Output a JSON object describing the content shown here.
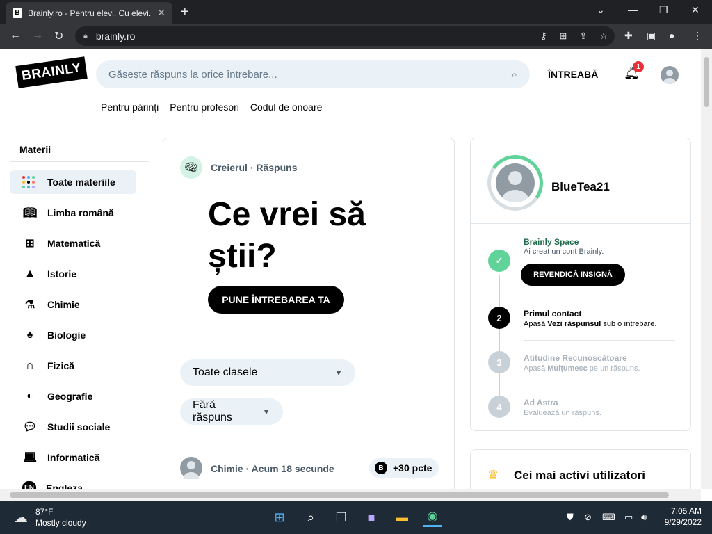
{
  "browser": {
    "tab_title": "Brainly.ro - Pentru elevi. Cu elevi.",
    "tab_favicon": "B",
    "url": "brainly.ro"
  },
  "header": {
    "logo": "BRAINLY",
    "search_placeholder": "Găsește răspuns la orice întrebare...",
    "ask_label": "ÎNTREABĂ",
    "notif_count": "1",
    "subnav": [
      "Pentru părinți",
      "Pentru profesori",
      "Codul de onoare"
    ]
  },
  "sidebar": {
    "title": "Materii",
    "items": [
      {
        "label": "Toate materiile",
        "icon": "all-subjects-icon"
      },
      {
        "label": "Limba română",
        "icon": "book-icon"
      },
      {
        "label": "Matematică",
        "icon": "math-icon"
      },
      {
        "label": "Istorie",
        "icon": "history-icon"
      },
      {
        "label": "Chimie",
        "icon": "flask-icon"
      },
      {
        "label": "Biologie",
        "icon": "leaf-icon"
      },
      {
        "label": "Fizică",
        "icon": "magnet-icon"
      },
      {
        "label": "Geografie",
        "icon": "globe-icon"
      },
      {
        "label": "Studii sociale",
        "icon": "chat-icon"
      },
      {
        "label": "Informatică",
        "icon": "laptop-icon"
      },
      {
        "label": "Engleza",
        "icon": "en-icon"
      }
    ]
  },
  "main": {
    "mascot_label": "Creierul",
    "mascot_sep": "·",
    "mascot_action": "Răspuns",
    "headline": "Ce vrei să știi?",
    "cta": "PUNE ÎNTREBAREA TA",
    "filter_grade": "Toate clasele",
    "filter_status": "Fără răspuns",
    "post_subject": "Chimie",
    "post_sep": "·",
    "post_time": "Acum 18 secunde",
    "post_points": "+30 pcte",
    "coin_glyph": "B"
  },
  "profile": {
    "username": "BlueTea21",
    "steps": [
      {
        "num": "✓",
        "title": "Brainly Space",
        "desc": "Ai creat un cont Brainly.",
        "state": "done"
      },
      {
        "num": "2",
        "title": "Primul contact",
        "desc_pre": "Apasă ",
        "desc_bold": "Vezi răspunsul",
        "desc_post": " sub o întrebare.",
        "state": "current"
      },
      {
        "num": "3",
        "title": "Atitudine Recunoscătoare",
        "desc_pre": "Apasă ",
        "desc_bold": "Mulțumesc",
        "desc_post": " pe un răspuns.",
        "state": "locked"
      },
      {
        "num": "4",
        "title": "Ad Astra",
        "desc": "Evaluează un răspuns.",
        "state": "locked"
      }
    ],
    "claim_button": "REVENDICĂ INSIGNĂ"
  },
  "active_users": {
    "title": "Cei mai activi utilizatori"
  },
  "taskbar": {
    "temp": "87°F",
    "weather": "Mostly cloudy",
    "time": "7:05 AM",
    "date": "9/29/2022"
  },
  "colors": {
    "accent_green": "#60d399",
    "search_bg": "#ebf2f7",
    "badge_red": "#e8303a"
  }
}
